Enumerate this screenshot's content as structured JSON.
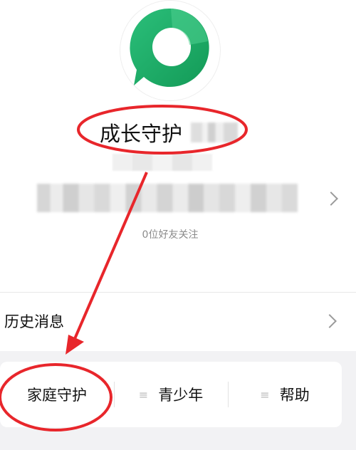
{
  "profile": {
    "name": "成长守护",
    "followers": "0位好友关注",
    "logo_icon": "chat-bubble-icon",
    "brand_color": "#1fb067"
  },
  "history": {
    "label": "历史消息"
  },
  "menu": {
    "items": [
      {
        "label": "家庭守护",
        "icon": "none"
      },
      {
        "label": "青少年",
        "icon": "menu-lines-icon"
      },
      {
        "label": "帮助",
        "icon": "menu-lines-icon"
      }
    ],
    "lines_glyph": "≡"
  },
  "annotation": {
    "color": "#e8262b"
  }
}
